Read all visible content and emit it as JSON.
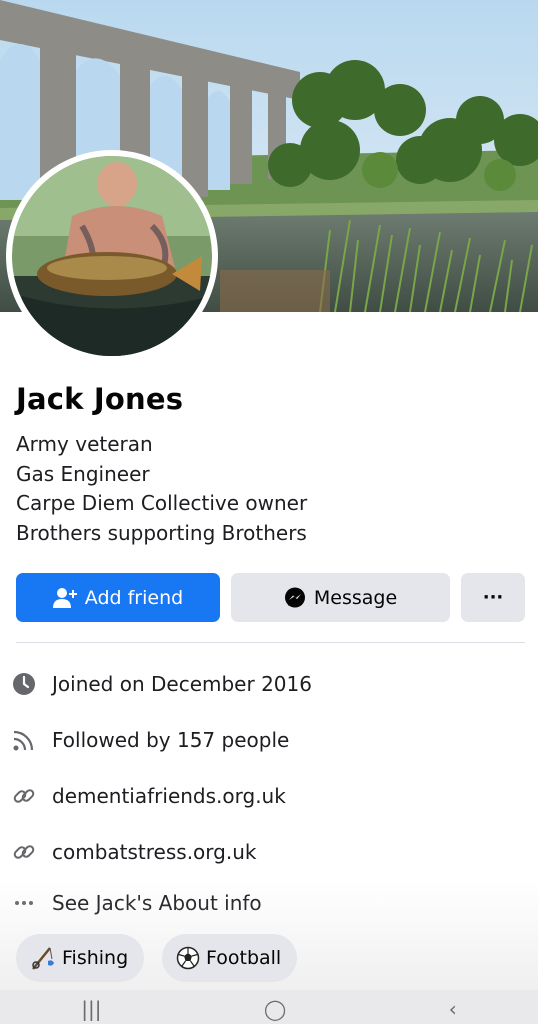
{
  "profile": {
    "name": "Jack Jones",
    "bio": [
      "Army veteran",
      "Gas Engineer",
      "Carpe Diem Collective owner",
      "Brothers supporting Brothers"
    ]
  },
  "actions": {
    "add_friend": "Add friend",
    "message": "Message",
    "more": "···"
  },
  "details": [
    {
      "icon": "clock-icon",
      "text": "Joined on December 2016"
    },
    {
      "icon": "rss-icon",
      "text": "Followed by 157 people"
    },
    {
      "icon": "link-icon",
      "text": "dementiafriends.org.uk"
    },
    {
      "icon": "link-icon",
      "text": "combatstress.org.uk"
    },
    {
      "icon": "more-dots-icon",
      "text": "See Jack's About info"
    }
  ],
  "interests": [
    {
      "icon": "fishing-icon",
      "label": "Fishing"
    },
    {
      "icon": "football-icon",
      "label": "Football"
    }
  ],
  "system_nav": {
    "recents": "|||",
    "home": "◯",
    "back": "‹"
  },
  "colors": {
    "primary": "#1877f2",
    "secondary_button": "#e4e6eb",
    "text": "#1c1e21",
    "icon": "#65676b"
  }
}
